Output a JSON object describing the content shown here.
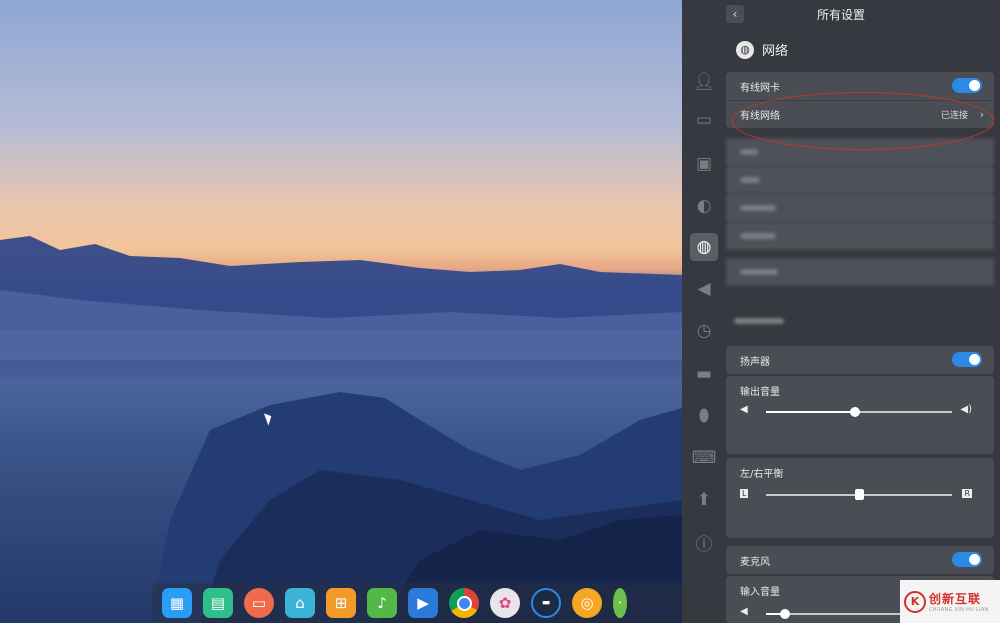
{
  "panel": {
    "title": "所有设置",
    "back_icon": "chevron-left-icon",
    "network": {
      "section_title": "网络",
      "wired_card_label": "有线网卡",
      "wired_network_label": "有线网络",
      "wired_network_status": "已连接"
    },
    "sound": {
      "speaker_label": "扬声器",
      "output_volume_label": "输出音量",
      "output_volume_value": 0.48,
      "balance_label": "左/右平衡",
      "balance_left": "L",
      "balance_right": "R",
      "balance_value": 0.5,
      "microphone_label": "麦克风",
      "input_volume_label": "输入音量",
      "input_volume_value": 0.1
    },
    "sidebar_icons": [
      "user-icon",
      "display-icon",
      "calendar-icon",
      "personalization-icon",
      "network-icon",
      "sound-icon",
      "time-icon",
      "power-icon",
      "mouse-icon",
      "keyboard-icon",
      "update-icon",
      "info-icon"
    ]
  },
  "dock": {
    "items": [
      "launcher-icon",
      "file-manager-icon",
      "screen-recorder-icon",
      "app-store-icon",
      "gift-icon",
      "music-icon",
      "video-icon",
      "chrome-icon",
      "settings-icon",
      "monitor-icon",
      "vpn-icon",
      "more-icon"
    ]
  },
  "watermark": {
    "cn": "创新互联",
    "en": "CHUANG XIN HU LIAN"
  },
  "colors": {
    "accent": "#2b8ae6",
    "panel_bg": "#36393f",
    "card_bg": "#4a4d54",
    "annotation": "#c0392b"
  }
}
